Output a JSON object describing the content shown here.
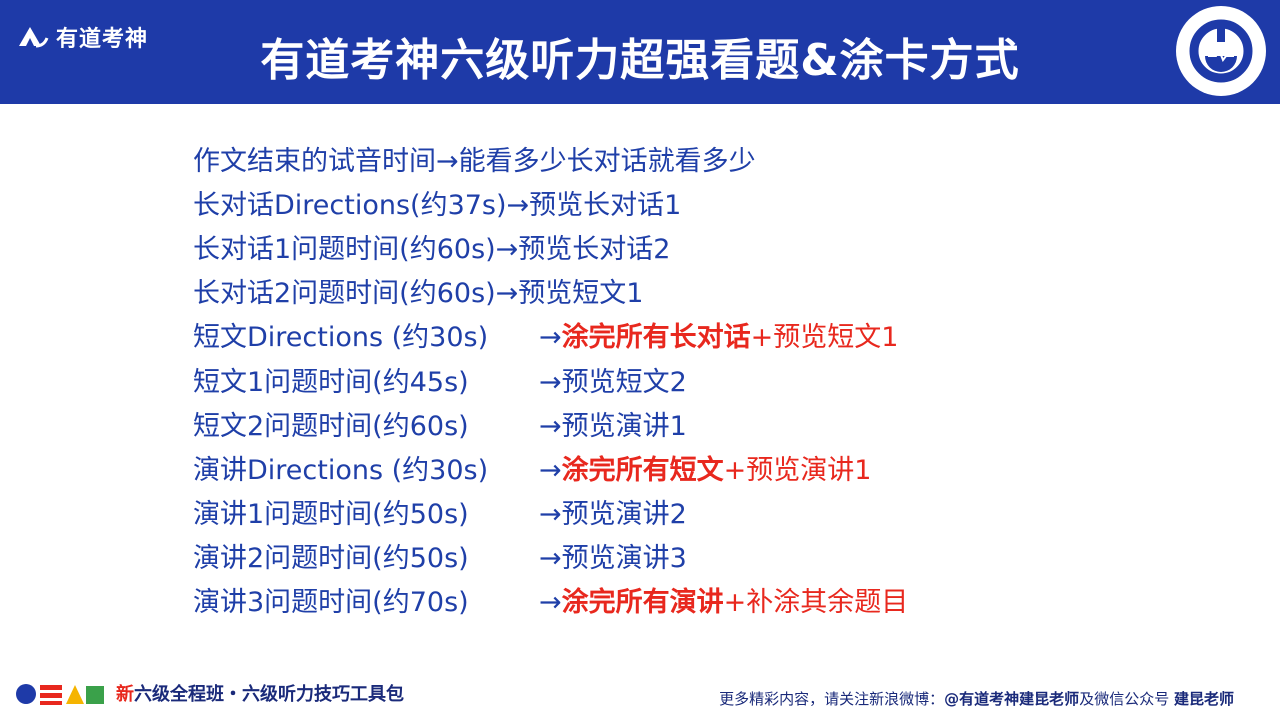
{
  "header": {
    "brand": "有道考神",
    "title": "有道考神六级听力超强看题&涂卡方式"
  },
  "rows": [
    {
      "left": "作文结束的试音时间",
      "arrow": "→",
      "plain": "能看多少长对话就看多少",
      "highlight": "",
      "after": ""
    },
    {
      "left": "长对话Directions(约37s)",
      "arrow": "→",
      "plain": "预览长对话1",
      "highlight": "",
      "after": ""
    },
    {
      "left": "长对话1问题时间(约60s) ",
      "arrow": "→",
      "plain": "预览长对话2",
      "highlight": "",
      "after": ""
    },
    {
      "left": "长对话2问题时间(约60s) ",
      "arrow": "→",
      "plain": "预览短文1",
      "highlight": "",
      "after": ""
    },
    {
      "left": "短文Directions (约30s)",
      "arrow": "→",
      "plain": "",
      "highlight": "涂完所有长对话",
      "after": "+预览短文1"
    },
    {
      "left": "短文1问题时间(约45s)",
      "arrow": "→",
      "plain": "预览短文2",
      "highlight": "",
      "after": ""
    },
    {
      "left": "短文2问题时间(约60s)",
      "arrow": "→",
      "plain": "预览演讲1",
      "highlight": "",
      "after": ""
    },
    {
      "left": "演讲Directions (约30s)",
      "arrow": "→",
      "plain": "",
      "highlight": "涂完所有短文",
      "after": "+预览演讲1"
    },
    {
      "left": "演讲1问题时间(约50s)",
      "arrow": "→",
      "plain": "预览演讲2",
      "highlight": "",
      "after": ""
    },
    {
      "left": "演讲2问题时间(约50s)",
      "arrow": "→",
      "plain": "预览演讲3",
      "highlight": "",
      "after": ""
    },
    {
      "left": "演讲3问题时间(约70s)",
      "arrow": "→",
      "plain": "",
      "highlight": "涂完所有演讲",
      "after": "+补涂其余题目"
    }
  ],
  "footer": {
    "course_new": "新",
    "course_rest": "六级全程班・六级听力技巧工具包",
    "promo_prefix": "更多精彩内容，请关注新浪微博：",
    "weibo": "@有道考神建昆老师",
    "promo_middle": "及微信公众号",
    "wechat": "建昆老师"
  },
  "colors": {
    "header_bg": "#1e3aa8",
    "text_blue": "#1f3fa8",
    "highlight_red": "#e8281e"
  }
}
